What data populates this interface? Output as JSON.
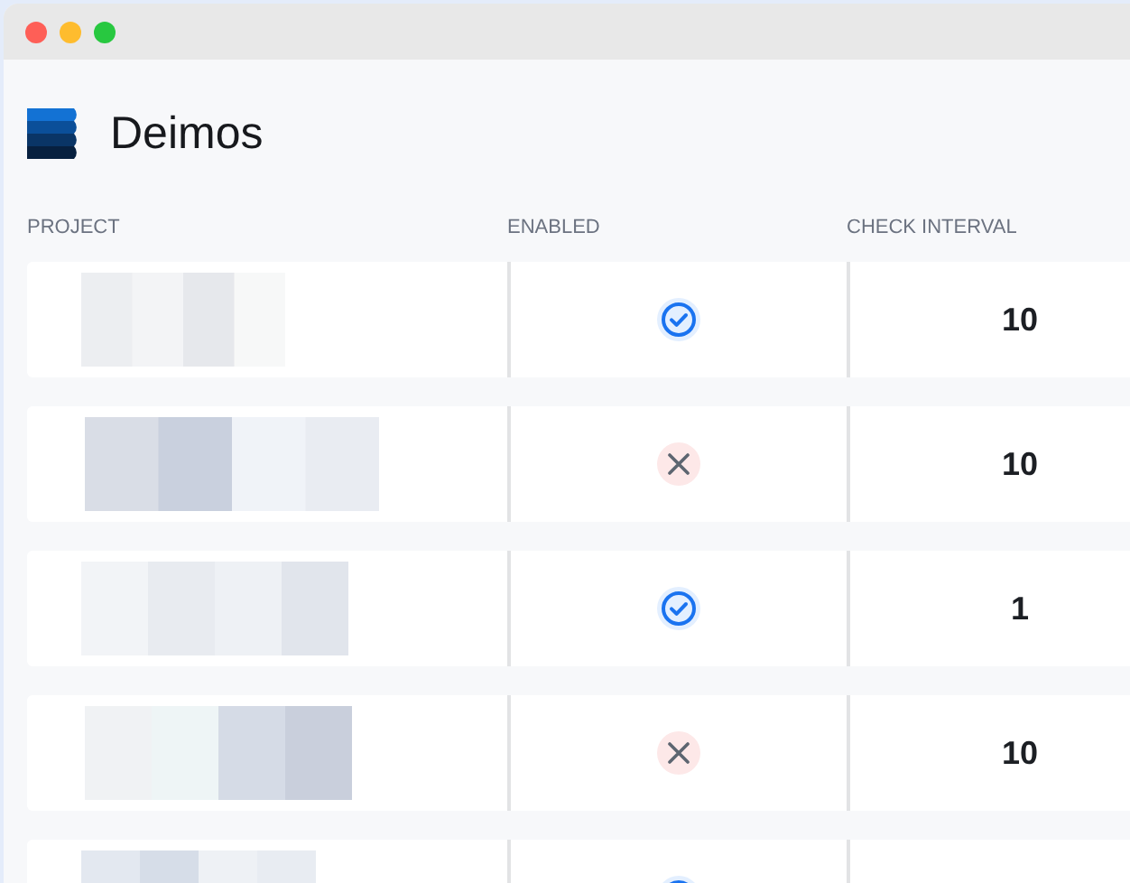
{
  "window": {
    "title": "Deimos"
  },
  "table": {
    "columns": [
      "PROJECT",
      "ENABLED",
      "CHECK INTERVAL"
    ],
    "rows": [
      {
        "enabled": true,
        "check_interval": "10"
      },
      {
        "enabled": false,
        "check_interval": "10"
      },
      {
        "enabled": true,
        "check_interval": "1"
      },
      {
        "enabled": false,
        "check_interval": "10"
      },
      {
        "enabled": true
      }
    ]
  }
}
